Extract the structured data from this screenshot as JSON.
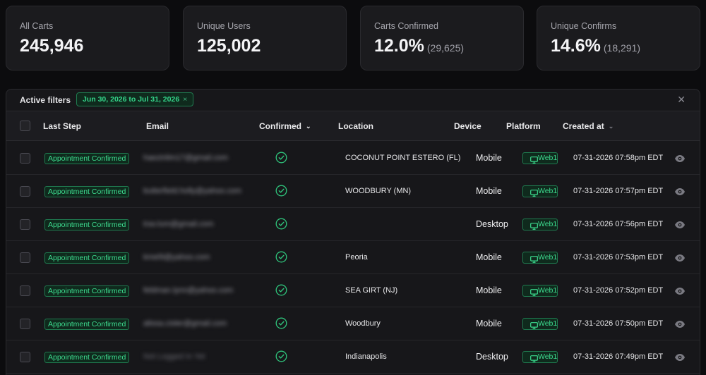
{
  "stats": [
    {
      "label": "All Carts",
      "value": "245,946",
      "sub": ""
    },
    {
      "label": "Unique Users",
      "value": "125,002",
      "sub": ""
    },
    {
      "label": "Carts Confirmed",
      "value": "12.0%",
      "sub": "(29,625)"
    },
    {
      "label": "Unique Confirms",
      "value": "14.6%",
      "sub": "(18,291)"
    }
  ],
  "filters": {
    "label": "Active filters",
    "chip": "Jun 30, 2026 to Jul 31, 2026",
    "chip_remove": "×",
    "close": "✕"
  },
  "table": {
    "headers": {
      "last_step": "Last Step",
      "email": "Email",
      "confirmed": "Confirmed",
      "location": "Location",
      "device": "Device",
      "platform": "Platform",
      "created_at": "Created at"
    },
    "rows": [
      {
        "last_step": "Appointment Confirmed",
        "email": "haezinlim17@gmail.com",
        "location": "COCONUT POINT ESTERO (FL)",
        "device": "Mobile",
        "platform": "Web1",
        "created": "07-31-2026 07:58pm EDT"
      },
      {
        "last_step": "Appointment Confirmed",
        "email": "butterfield.holly@yahoo.com",
        "location": "WOODBURY (MN)",
        "device": "Mobile",
        "platform": "Web1",
        "created": "07-31-2026 07:57pm EDT"
      },
      {
        "last_step": "Appointment Confirmed",
        "email": "trav.lum@gmail.com",
        "location": "",
        "device": "Desktop",
        "platform": "Web1",
        "created": "07-31-2026 07:56pm EDT"
      },
      {
        "last_step": "Appointment Confirmed",
        "email": "kmel9@yahoo.com",
        "location": "Peoria",
        "device": "Mobile",
        "platform": "Web1",
        "created": "07-31-2026 07:53pm EDT"
      },
      {
        "last_step": "Appointment Confirmed",
        "email": "feldman.lynn@yahoo.com",
        "location": "SEA GIRT (NJ)",
        "device": "Mobile",
        "platform": "Web1",
        "created": "07-31-2026 07:52pm EDT"
      },
      {
        "last_step": "Appointment Confirmed",
        "email": "alissa.cisler@gmail.com",
        "location": "Woodbury",
        "device": "Mobile",
        "platform": "Web1",
        "created": "07-31-2026 07:50pm EDT"
      },
      {
        "last_step": "Appointment Confirmed",
        "email": "Not Logged In Yet",
        "location": "Indianapolis",
        "device": "Desktop",
        "platform": "Web1",
        "created": "07-31-2026 07:49pm EDT"
      }
    ]
  },
  "colors": {
    "accent": "#3ddc8f",
    "badge_bg": "#0f2a1d",
    "badge_border": "#1f7a4f"
  },
  "icons": {
    "confirmed": "check-circle-icon",
    "platform": "monitor-icon",
    "view": "eye-icon",
    "sort": "chevron-down-icon"
  }
}
